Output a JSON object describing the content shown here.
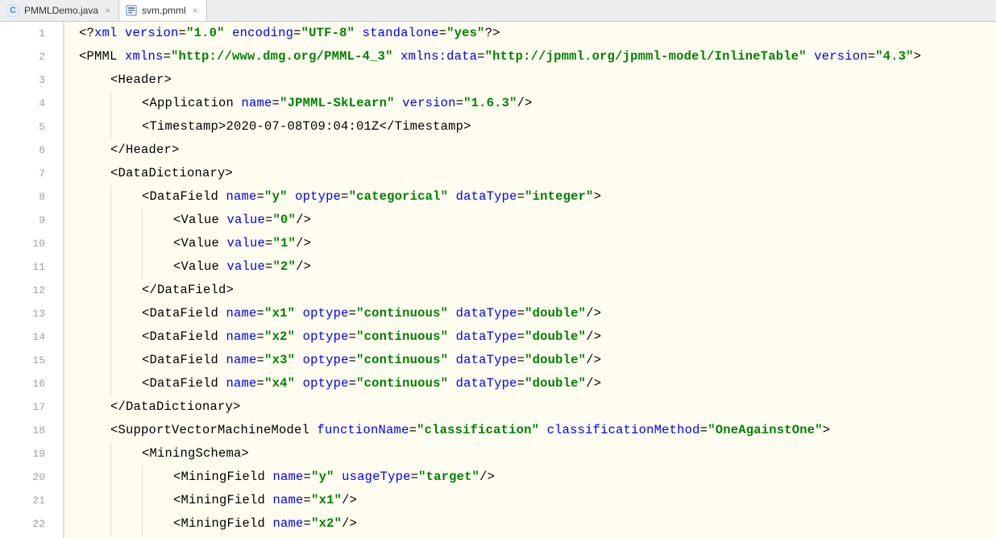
{
  "tabs": [
    {
      "label": "PMMLDemo.java",
      "active": false,
      "icon_kind": "java"
    },
    {
      "label": "svm.pmml",
      "active": true,
      "icon_kind": "xml"
    }
  ],
  "line_count": 22,
  "code_lines": [
    {
      "indent": 0,
      "guides": [],
      "tokens": [
        {
          "cls": "t-punc",
          "txt": "<?"
        },
        {
          "cls": "t-attr",
          "txt": "xml version"
        },
        {
          "cls": "t-punc",
          "txt": "="
        },
        {
          "cls": "t-str",
          "txt": "\"1.0\""
        },
        {
          "cls": "t-attr",
          "txt": " encoding"
        },
        {
          "cls": "t-punc",
          "txt": "="
        },
        {
          "cls": "t-str",
          "txt": "\"UTF-8\""
        },
        {
          "cls": "t-attr",
          "txt": " standalone"
        },
        {
          "cls": "t-punc",
          "txt": "="
        },
        {
          "cls": "t-str",
          "txt": "\"yes\""
        },
        {
          "cls": "t-punc",
          "txt": "?>"
        }
      ]
    },
    {
      "indent": 0,
      "guides": [],
      "tokens": [
        {
          "cls": "t-punc",
          "txt": "<PMML "
        },
        {
          "cls": "t-attr",
          "txt": "xmlns"
        },
        {
          "cls": "t-punc",
          "txt": "="
        },
        {
          "cls": "t-str",
          "txt": "\"http://www.dmg.org/PMML-4_3\""
        },
        {
          "cls": "t-attr",
          "txt": " xmlns:data"
        },
        {
          "cls": "t-punc",
          "txt": "="
        },
        {
          "cls": "t-str",
          "txt": "\"http://jpmml.org/jpmml-model/InlineTable\""
        },
        {
          "cls": "t-attr",
          "txt": " version"
        },
        {
          "cls": "t-punc",
          "txt": "="
        },
        {
          "cls": "t-str",
          "txt": "\"4.3\""
        },
        {
          "cls": "t-punc",
          "txt": ">"
        }
      ]
    },
    {
      "indent": 1,
      "guides": [],
      "tokens": [
        {
          "cls": "t-punc",
          "txt": "<Header>"
        }
      ]
    },
    {
      "indent": 2,
      "guides": [
        1
      ],
      "tokens": [
        {
          "cls": "t-punc",
          "txt": "<Application "
        },
        {
          "cls": "t-attr",
          "txt": "name"
        },
        {
          "cls": "t-punc",
          "txt": "="
        },
        {
          "cls": "t-str",
          "txt": "\"JPMML-SkLearn\""
        },
        {
          "cls": "t-attr",
          "txt": " version"
        },
        {
          "cls": "t-punc",
          "txt": "="
        },
        {
          "cls": "t-str",
          "txt": "\"1.6.3\""
        },
        {
          "cls": "t-punc",
          "txt": "/>"
        }
      ]
    },
    {
      "indent": 2,
      "guides": [
        1
      ],
      "tokens": [
        {
          "cls": "t-punc",
          "txt": "<Timestamp>"
        },
        {
          "cls": "t-text",
          "txt": "2020-07-08T09:04:01Z"
        },
        {
          "cls": "t-punc",
          "txt": "</Timestamp>"
        }
      ]
    },
    {
      "indent": 1,
      "guides": [],
      "tokens": [
        {
          "cls": "t-punc",
          "txt": "</Header>"
        }
      ]
    },
    {
      "indent": 1,
      "guides": [],
      "tokens": [
        {
          "cls": "t-punc",
          "txt": "<DataDictionary>"
        }
      ]
    },
    {
      "indent": 2,
      "guides": [
        1
      ],
      "tokens": [
        {
          "cls": "t-punc",
          "txt": "<DataField "
        },
        {
          "cls": "t-attr",
          "txt": "name"
        },
        {
          "cls": "t-punc",
          "txt": "="
        },
        {
          "cls": "t-str",
          "txt": "\"y\""
        },
        {
          "cls": "t-attr u",
          "txt": " optype"
        },
        {
          "cls": "t-punc",
          "txt": "="
        },
        {
          "cls": "t-str",
          "txt": "\"categorical\""
        },
        {
          "cls": "t-attr",
          "txt": " dataType"
        },
        {
          "cls": "t-punc",
          "txt": "="
        },
        {
          "cls": "t-str",
          "txt": "\"integer\""
        },
        {
          "cls": "t-punc",
          "txt": ">"
        }
      ]
    },
    {
      "indent": 3,
      "guides": [
        1,
        2
      ],
      "tokens": [
        {
          "cls": "t-punc",
          "txt": "<Value "
        },
        {
          "cls": "t-attr",
          "txt": "value"
        },
        {
          "cls": "t-punc",
          "txt": "="
        },
        {
          "cls": "t-str",
          "txt": "\"0\""
        },
        {
          "cls": "t-punc",
          "txt": "/>"
        }
      ]
    },
    {
      "indent": 3,
      "guides": [
        1,
        2
      ],
      "tokens": [
        {
          "cls": "t-punc",
          "txt": "<Value "
        },
        {
          "cls": "t-attr",
          "txt": "value"
        },
        {
          "cls": "t-punc",
          "txt": "="
        },
        {
          "cls": "t-str",
          "txt": "\"1\""
        },
        {
          "cls": "t-punc",
          "txt": "/>"
        }
      ]
    },
    {
      "indent": 3,
      "guides": [
        1,
        2
      ],
      "tokens": [
        {
          "cls": "t-punc",
          "txt": "<Value "
        },
        {
          "cls": "t-attr",
          "txt": "value"
        },
        {
          "cls": "t-punc",
          "txt": "="
        },
        {
          "cls": "t-str",
          "txt": "\"2\""
        },
        {
          "cls": "t-punc",
          "txt": "/>"
        }
      ]
    },
    {
      "indent": 2,
      "guides": [
        1
      ],
      "tokens": [
        {
          "cls": "t-punc",
          "txt": "</DataField>"
        }
      ]
    },
    {
      "indent": 2,
      "guides": [
        1
      ],
      "tokens": [
        {
          "cls": "t-punc",
          "txt": "<DataField "
        },
        {
          "cls": "t-attr",
          "txt": "name"
        },
        {
          "cls": "t-punc",
          "txt": "="
        },
        {
          "cls": "t-str",
          "txt": "\"x1\""
        },
        {
          "cls": "t-attr u",
          "txt": " optype"
        },
        {
          "cls": "t-punc",
          "txt": "="
        },
        {
          "cls": "t-str",
          "txt": "\"continuous\""
        },
        {
          "cls": "t-attr",
          "txt": " dataType"
        },
        {
          "cls": "t-punc",
          "txt": "="
        },
        {
          "cls": "t-str",
          "txt": "\"double\""
        },
        {
          "cls": "t-punc",
          "txt": "/>"
        }
      ]
    },
    {
      "indent": 2,
      "guides": [
        1
      ],
      "tokens": [
        {
          "cls": "t-punc",
          "txt": "<DataField "
        },
        {
          "cls": "t-attr",
          "txt": "name"
        },
        {
          "cls": "t-punc",
          "txt": "="
        },
        {
          "cls": "t-str",
          "txt": "\"x2\""
        },
        {
          "cls": "t-attr u",
          "txt": " optype"
        },
        {
          "cls": "t-punc",
          "txt": "="
        },
        {
          "cls": "t-str",
          "txt": "\"continuous\""
        },
        {
          "cls": "t-attr",
          "txt": " dataType"
        },
        {
          "cls": "t-punc",
          "txt": "="
        },
        {
          "cls": "t-str",
          "txt": "\"double\""
        },
        {
          "cls": "t-punc",
          "txt": "/>"
        }
      ]
    },
    {
      "indent": 2,
      "guides": [
        1
      ],
      "tokens": [
        {
          "cls": "t-punc",
          "txt": "<DataField "
        },
        {
          "cls": "t-attr",
          "txt": "name"
        },
        {
          "cls": "t-punc",
          "txt": "="
        },
        {
          "cls": "t-str",
          "txt": "\"x3\""
        },
        {
          "cls": "t-attr u",
          "txt": " optype"
        },
        {
          "cls": "t-punc",
          "txt": "="
        },
        {
          "cls": "t-str",
          "txt": "\"continuous\""
        },
        {
          "cls": "t-attr",
          "txt": " dataType"
        },
        {
          "cls": "t-punc",
          "txt": "="
        },
        {
          "cls": "t-str",
          "txt": "\"double\""
        },
        {
          "cls": "t-punc",
          "txt": "/>"
        }
      ]
    },
    {
      "indent": 2,
      "guides": [
        1
      ],
      "tokens": [
        {
          "cls": "t-punc",
          "txt": "<DataField "
        },
        {
          "cls": "t-attr",
          "txt": "name"
        },
        {
          "cls": "t-punc",
          "txt": "="
        },
        {
          "cls": "t-str",
          "txt": "\"x4\""
        },
        {
          "cls": "t-attr u",
          "txt": " optype"
        },
        {
          "cls": "t-punc",
          "txt": "="
        },
        {
          "cls": "t-str",
          "txt": "\"continuous\""
        },
        {
          "cls": "t-attr",
          "txt": " dataType"
        },
        {
          "cls": "t-punc",
          "txt": "="
        },
        {
          "cls": "t-str",
          "txt": "\"double\""
        },
        {
          "cls": "t-punc",
          "txt": "/>"
        }
      ]
    },
    {
      "indent": 1,
      "guides": [],
      "tokens": [
        {
          "cls": "t-punc",
          "txt": "</DataDictionary>"
        }
      ]
    },
    {
      "indent": 1,
      "guides": [],
      "tokens": [
        {
          "cls": "t-punc",
          "txt": "<SupportVectorMachineModel "
        },
        {
          "cls": "t-attr",
          "txt": "functionName"
        },
        {
          "cls": "t-punc",
          "txt": "="
        },
        {
          "cls": "t-str",
          "txt": "\"classification\""
        },
        {
          "cls": "t-attr",
          "txt": " classificationMethod"
        },
        {
          "cls": "t-punc",
          "txt": "="
        },
        {
          "cls": "t-str",
          "txt": "\"OneAgainstOne\""
        },
        {
          "cls": "t-punc",
          "txt": ">"
        }
      ]
    },
    {
      "indent": 2,
      "guides": [
        1
      ],
      "tokens": [
        {
          "cls": "t-punc",
          "txt": "<MiningSchema>"
        }
      ]
    },
    {
      "indent": 3,
      "guides": [
        1,
        2
      ],
      "tokens": [
        {
          "cls": "t-punc",
          "txt": "<MiningField "
        },
        {
          "cls": "t-attr",
          "txt": "name"
        },
        {
          "cls": "t-punc",
          "txt": "="
        },
        {
          "cls": "t-str",
          "txt": "\"y\""
        },
        {
          "cls": "t-attr",
          "txt": " usageType"
        },
        {
          "cls": "t-punc",
          "txt": "="
        },
        {
          "cls": "t-str",
          "txt": "\"target\""
        },
        {
          "cls": "t-punc",
          "txt": "/>"
        }
      ]
    },
    {
      "indent": 3,
      "guides": [
        1,
        2
      ],
      "tokens": [
        {
          "cls": "t-punc",
          "txt": "<MiningField "
        },
        {
          "cls": "t-attr",
          "txt": "name"
        },
        {
          "cls": "t-punc",
          "txt": "="
        },
        {
          "cls": "t-str",
          "txt": "\"x1\""
        },
        {
          "cls": "t-punc",
          "txt": "/>"
        }
      ]
    },
    {
      "indent": 3,
      "guides": [
        1,
        2
      ],
      "tokens": [
        {
          "cls": "t-punc",
          "txt": "<MiningField "
        },
        {
          "cls": "t-attr",
          "txt": "name"
        },
        {
          "cls": "t-punc",
          "txt": "="
        },
        {
          "cls": "t-str",
          "txt": "\"x2\""
        },
        {
          "cls": "t-punc",
          "txt": "/>"
        }
      ]
    }
  ]
}
